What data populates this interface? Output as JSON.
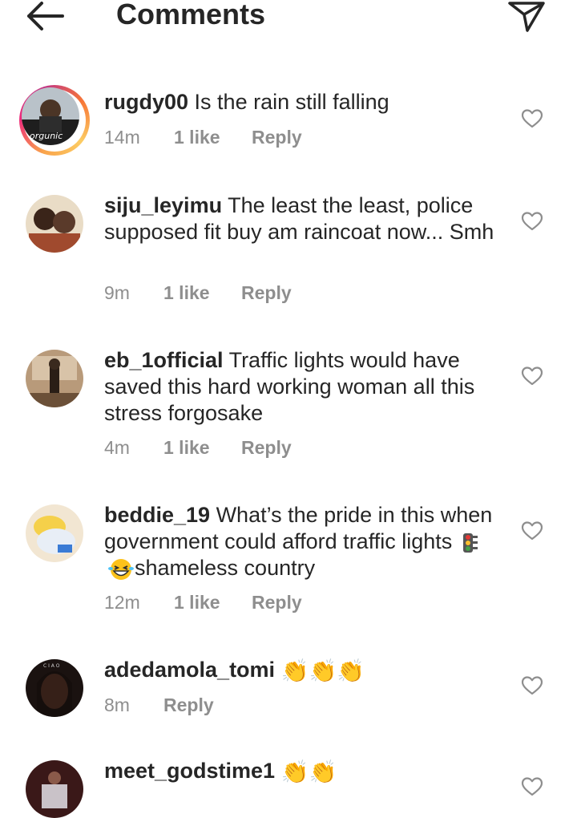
{
  "header": {
    "title": "Comments"
  },
  "comments": [
    {
      "username": "rugdy00",
      "text": " Is the rain still falling",
      "time": "14m",
      "likes": "1 like",
      "reply": "Reply",
      "has_story": true,
      "avatar_color": "#6d7b88"
    },
    {
      "username": "siju_leyimu",
      "text": " The least the least, police supposed fit buy am raincoat now... Smh",
      "time": "9m",
      "likes": "1 like",
      "reply": "Reply",
      "avatar_color": "#3b2a22"
    },
    {
      "username": "eb_1official",
      "text": " Traffic lights would have saved this hard working woman all this stress forgosake",
      "time": "4m",
      "likes": "1 like",
      "reply": "Reply",
      "avatar_color": "#8a6a4a"
    },
    {
      "username": "beddie_19",
      "text": " What’s the pride in this when government could afford traffic lights",
      "text_after": "shameless country",
      "time": "12m",
      "likes": "1 like",
      "reply": "Reply",
      "avatar_color": "#cfd7e0"
    },
    {
      "username": "adedamola_tomi",
      "text": "",
      "time": "8m",
      "reply": "Reply",
      "avatar_color": "#2a1a16"
    },
    {
      "username": "meet_godstime1",
      "text": "",
      "avatar_color": "#4a2020"
    }
  ],
  "icons": {
    "back": "arrow-left-icon",
    "send": "send-icon",
    "heart": "heart-outline-icon",
    "clap": "clapping-hands-emoji",
    "traffic_light": "traffic-light-emoji",
    "laugh": "grinning-squinting-face-emoji"
  },
  "colors": {
    "text_primary": "#262626",
    "text_secondary": "#8e8e8e",
    "background": "#ffffff"
  }
}
